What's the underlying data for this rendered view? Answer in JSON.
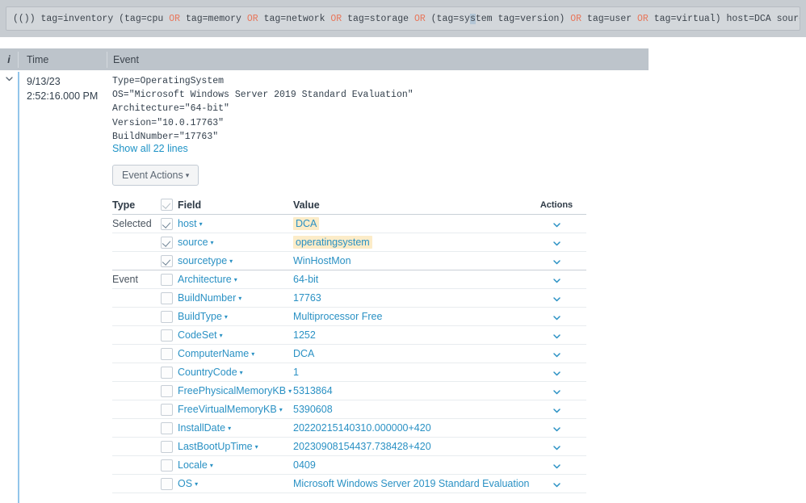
{
  "search": {
    "query_prefix": "(()) tag=inventory (tag=cpu ",
    "full_query": "(()) tag=inventory (tag=cpu OR tag=memory OR tag=network OR tag=storage OR (tag=system tag=version) OR tag=user OR tag=virtual) host=DCA source=operatingsystem",
    "tokens": [
      {
        "text": "(()) tag=inventory (tag=cpu ",
        "type": "plain"
      },
      {
        "text": "OR",
        "type": "keyword"
      },
      {
        "text": " tag=memory ",
        "type": "plain"
      },
      {
        "text": "OR",
        "type": "keyword"
      },
      {
        "text": " tag=network ",
        "type": "plain"
      },
      {
        "text": "OR",
        "type": "keyword"
      },
      {
        "text": " tag=storage ",
        "type": "plain"
      },
      {
        "text": "OR",
        "type": "keyword"
      },
      {
        "text": " (tag=sy",
        "type": "plain"
      },
      {
        "text": "s",
        "type": "selected"
      },
      {
        "text": "tem tag=version) ",
        "type": "plain"
      },
      {
        "text": "OR",
        "type": "keyword"
      },
      {
        "text": " tag=user ",
        "type": "plain"
      },
      {
        "text": "OR",
        "type": "keyword"
      },
      {
        "text": " tag=virtual) host=DCA source=operatingsystem",
        "type": "plain"
      }
    ]
  },
  "results_header": {
    "info_label": "i",
    "time_label": "Time",
    "event_label": "Event"
  },
  "event": {
    "expand_icon": "chevron-down",
    "date": "9/13/23",
    "time": "2:52:16.000 PM",
    "raw_lines": [
      "Type=OperatingSystem",
      "OS=\"Microsoft Windows Server 2019 Standard Evaluation\"",
      "Architecture=\"64-bit\"",
      "Version=\"10.0.17763\"",
      "BuildNumber=\"17763\""
    ],
    "show_all_lines": "Show all 22 lines",
    "event_actions_label": "Event Actions"
  },
  "fields_table": {
    "columns": {
      "type": "Type",
      "field": "Field",
      "value": "Value",
      "actions": "Actions"
    },
    "header_checkbox_checked": true,
    "rows": [
      {
        "type": "Selected",
        "checked": true,
        "field": "host",
        "value": "DCA",
        "highlight": true,
        "action_icon": "chevron-down"
      },
      {
        "type": "",
        "checked": true,
        "field": "source",
        "value": "operatingsystem",
        "highlight": true,
        "action_icon": "chevron-down"
      },
      {
        "type": "",
        "checked": true,
        "field": "sourcetype",
        "value": "WinHostMon",
        "highlight": false,
        "action_icon": "chevron-down",
        "group_end": true
      },
      {
        "type": "Event",
        "checked": false,
        "field": "Architecture",
        "value": "64-bit",
        "highlight": false,
        "action_icon": "chevron-down"
      },
      {
        "type": "",
        "checked": false,
        "field": "BuildNumber",
        "value": "17763",
        "highlight": false,
        "action_icon": "chevron-down"
      },
      {
        "type": "",
        "checked": false,
        "field": "BuildType",
        "value": "Multiprocessor Free",
        "highlight": false,
        "action_icon": "chevron-down"
      },
      {
        "type": "",
        "checked": false,
        "field": "CodeSet",
        "value": "1252",
        "highlight": false,
        "action_icon": "chevron-down"
      },
      {
        "type": "",
        "checked": false,
        "field": "ComputerName",
        "value": "DCA",
        "highlight": false,
        "action_icon": "chevron-down"
      },
      {
        "type": "",
        "checked": false,
        "field": "CountryCode",
        "value": "1",
        "highlight": false,
        "action_icon": "chevron-down"
      },
      {
        "type": "",
        "checked": false,
        "field": "FreePhysicalMemoryKB",
        "value": "5313864",
        "highlight": false,
        "action_icon": "chevron-down"
      },
      {
        "type": "",
        "checked": false,
        "field": "FreeVirtualMemoryKB",
        "value": "5390608",
        "highlight": false,
        "action_icon": "chevron-down"
      },
      {
        "type": "",
        "checked": false,
        "field": "InstallDate",
        "value": "20220215140310.000000+420",
        "highlight": false,
        "action_icon": "chevron-down"
      },
      {
        "type": "",
        "checked": false,
        "field": "LastBootUpTime",
        "value": "20230908154437.738428+420",
        "highlight": false,
        "action_icon": "chevron-down"
      },
      {
        "type": "",
        "checked": false,
        "field": "Locale",
        "value": "0409",
        "highlight": false,
        "action_icon": "chevron-down"
      },
      {
        "type": "",
        "checked": false,
        "field": "OS",
        "value": "Microsoft Windows Server 2019 Standard Evaluation",
        "highlight": false,
        "action_icon": "chevron-down"
      }
    ]
  },
  "colors": {
    "link": "#2a91c4",
    "accent_bar": "#93c5ea",
    "highlight_bg": "#fcecc8",
    "search_bg": "#c7ccd1",
    "header_bg": "#bdc4cb",
    "keyword": "#e8765a"
  }
}
